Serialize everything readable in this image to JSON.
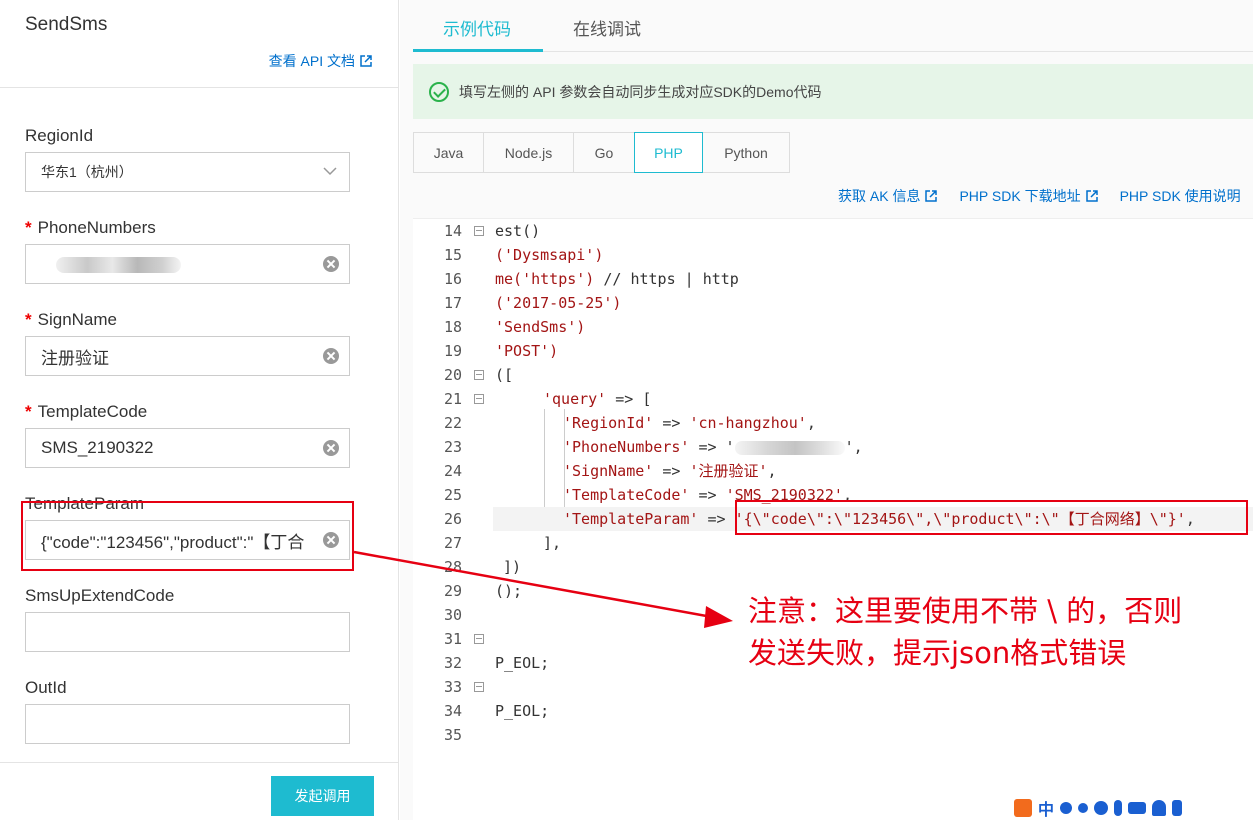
{
  "left": {
    "title": "SendSms",
    "api_doc_link": "查看 API 文档",
    "fields": {
      "region": {
        "label": "RegionId",
        "value": "华东1（杭州）"
      },
      "phone": {
        "label": "PhoneNumbers",
        "required": "*"
      },
      "sign": {
        "label": "SignName",
        "required": "*",
        "value": "注册验证"
      },
      "template_code": {
        "label": "TemplateCode",
        "required": "*",
        "value": "SMS_2190322"
      },
      "template_param": {
        "label": "TemplateParam",
        "value": "{\"code\":\"123456\",\"product\":\"【丁合"
      },
      "sms_up": {
        "label": "SmsUpExtendCode"
      },
      "out_id": {
        "label": "OutId"
      }
    },
    "submit_label": "发起调用"
  },
  "right": {
    "tabs": [
      "示例代码",
      "在线调试"
    ],
    "notice": "填写左侧的 API 参数会自动同步生成对应SDK的Demo代码",
    "lang_tabs": [
      "Java",
      "Node.js",
      "Go",
      "PHP",
      "Python"
    ],
    "active_lang": "PHP",
    "links": [
      "获取 AK 信息",
      "PHP SDK 下载地址",
      "PHP SDK 使用说明"
    ],
    "code": {
      "l14": "est()",
      "l15": "('Dysmsapi')",
      "l16a": "me('https')",
      "l16b": " // https | http",
      "l17": "('2017-05-25')",
      "l18": "'SendSms')",
      "l19": "'POST')",
      "l20": "([",
      "l21a": "'query'",
      "l21b": " => [",
      "l22a": "'RegionId'",
      "l22b": " => ",
      "l22c": "'cn-hangzhou'",
      "l22d": ",",
      "l23a": "'PhoneNumbers'",
      "l23b": " => '",
      "l23c": "',",
      "l24a": "'SignName'",
      "l24b": " => ",
      "l24c": "'注册验证'",
      "l24d": ",",
      "l25a": "'TemplateCode'",
      "l25b": " => ",
      "l25c": "'SMS_2190322'",
      "l25d": ",",
      "l26a": "'TemplateParam'",
      "l26b": " => ",
      "l26c": "'{\\\"code\\\":\\\"123456\\\",\\\"product\\\":\\\"【丁合网络】\\\"}'",
      "l26d": ",",
      "l27": "],",
      "l28": "])",
      "l29": "();",
      "l32": "P_EOL;",
      "l34": "P_EOL;"
    },
    "line_numbers": [
      "14",
      "15",
      "16",
      "17",
      "18",
      "19",
      "20",
      "21",
      "22",
      "23",
      "24",
      "25",
      "26",
      "27",
      "28",
      "29",
      "30",
      "31",
      "32",
      "33",
      "34",
      "35"
    ]
  },
  "annotation": {
    "line1": "注意：这里要使用不带 \\ 的，否则",
    "line2": "发送失败，提示json格式错误"
  },
  "colors": {
    "accent": "#1ebbd0",
    "annotation_red": "#e60012",
    "link_blue": "#0070cc",
    "string_red": "#a31515"
  }
}
